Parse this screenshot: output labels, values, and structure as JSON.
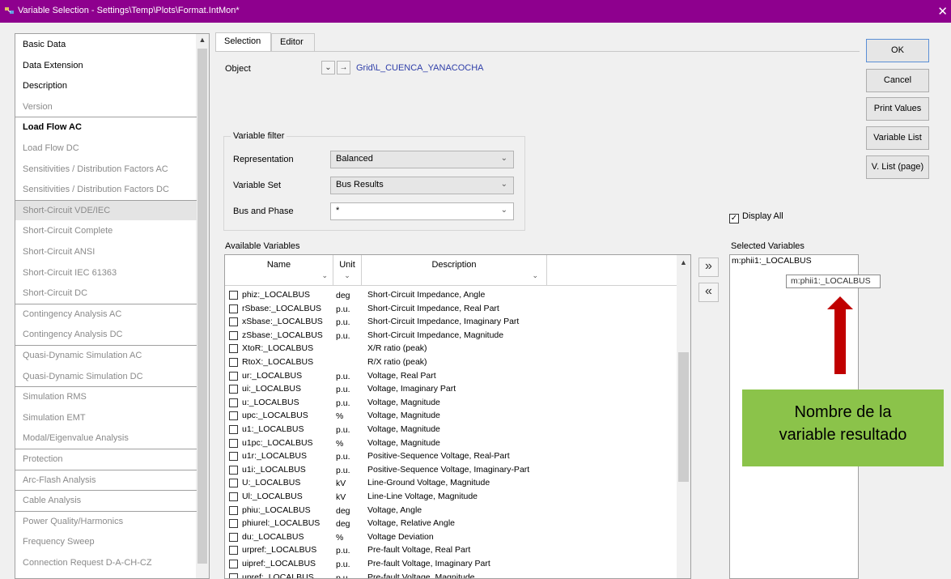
{
  "window": {
    "title": "Variable Selection - Settings\\Temp\\Plots\\Format.IntMon*",
    "close": "✕"
  },
  "sidebar": {
    "items": [
      {
        "label": "Basic Data",
        "active": true
      },
      {
        "label": "Data Extension",
        "active": true
      },
      {
        "label": "Description",
        "active": true
      },
      {
        "label": "Version",
        "active": false
      },
      {
        "label": "Load Flow AC",
        "active": true,
        "bold": true
      },
      {
        "label": "Load Flow DC",
        "active": false
      },
      {
        "label": "Sensitivities / Distribution Factors AC",
        "active": false
      },
      {
        "label": "Sensitivities / Distribution Factors DC",
        "active": false
      },
      {
        "label": "Short-Circuit VDE/IEC",
        "active": false,
        "selected": true
      },
      {
        "label": "Short-Circuit Complete",
        "active": false
      },
      {
        "label": "Short-Circuit ANSI",
        "active": false
      },
      {
        "label": "Short-Circuit IEC 61363",
        "active": false
      },
      {
        "label": "Short-Circuit DC",
        "active": false
      },
      {
        "label": "Contingency Analysis AC",
        "active": false
      },
      {
        "label": "Contingency Analysis DC",
        "active": false
      },
      {
        "label": "Quasi-Dynamic Simulation AC",
        "active": false
      },
      {
        "label": "Quasi-Dynamic Simulation DC",
        "active": false
      },
      {
        "label": "Simulation RMS",
        "active": false
      },
      {
        "label": "Simulation EMT",
        "active": false
      },
      {
        "label": "Modal/Eigenvalue Analysis",
        "active": false
      },
      {
        "label": "Protection",
        "active": false
      },
      {
        "label": "Arc-Flash Analysis",
        "active": false
      },
      {
        "label": "Cable Analysis",
        "active": false
      },
      {
        "label": "Power Quality/Harmonics",
        "active": false
      },
      {
        "label": "Frequency Sweep",
        "active": false
      },
      {
        "label": "Connection Request D-A-CH-CZ",
        "active": false
      }
    ]
  },
  "tabs": [
    {
      "label": "Selection",
      "selected": true
    },
    {
      "label": "Editor",
      "selected": false
    }
  ],
  "object": {
    "label": "Object",
    "value": "Grid\\L_CUENCA_YANACOCHA",
    "dropdown_glyph": "⌄",
    "goto_glyph": "→"
  },
  "filter": {
    "title": "Variable filter",
    "representation": {
      "label": "Representation",
      "value": "Balanced"
    },
    "variable_set": {
      "label": "Variable Set",
      "value": "Bus Results"
    },
    "bus_phase": {
      "label": "Bus and Phase",
      "value": "*"
    }
  },
  "available": {
    "label": "Available Variables",
    "columns": [
      "Name",
      "Unit",
      "Description"
    ],
    "rows": [
      {
        "name": "phiz:_LOCALBUS",
        "unit": "deg",
        "desc": "Short-Circuit Impedance, Angle"
      },
      {
        "name": "rSbase:_LOCALBUS",
        "unit": "p.u.",
        "desc": "Short-Circuit Impedance, Real Part"
      },
      {
        "name": "xSbase:_LOCALBUS",
        "unit": "p.u.",
        "desc": "Short-Circuit Impedance, Imaginary Part"
      },
      {
        "name": "zSbase:_LOCALBUS",
        "unit": "p.u.",
        "desc": "Short-Circuit Impedance, Magnitude"
      },
      {
        "name": "XtoR:_LOCALBUS",
        "unit": "",
        "desc": "X/R ratio (peak)"
      },
      {
        "name": "RtoX:_LOCALBUS",
        "unit": "",
        "desc": "R/X ratio (peak)"
      },
      {
        "name": "ur:_LOCALBUS",
        "unit": "p.u.",
        "desc": "Voltage, Real Part"
      },
      {
        "name": "ui:_LOCALBUS",
        "unit": "p.u.",
        "desc": "Voltage, Imaginary Part"
      },
      {
        "name": "u:_LOCALBUS",
        "unit": "p.u.",
        "desc": "Voltage, Magnitude"
      },
      {
        "name": "upc:_LOCALBUS",
        "unit": "%",
        "desc": "Voltage, Magnitude"
      },
      {
        "name": "u1:_LOCALBUS",
        "unit": "p.u.",
        "desc": "Voltage, Magnitude"
      },
      {
        "name": "u1pc:_LOCALBUS",
        "unit": "%",
        "desc": "Voltage, Magnitude"
      },
      {
        "name": "u1r:_LOCALBUS",
        "unit": "p.u.",
        "desc": "Positive-Sequence Voltage, Real-Part"
      },
      {
        "name": "u1i:_LOCALBUS",
        "unit": "p.u.",
        "desc": "Positive-Sequence Voltage, Imaginary-Part"
      },
      {
        "name": "U:_LOCALBUS",
        "unit": "kV",
        "desc": "Line-Ground Voltage, Magnitude"
      },
      {
        "name": "Ul:_LOCALBUS",
        "unit": "kV",
        "desc": "Line-Line Voltage, Magnitude"
      },
      {
        "name": "phiu:_LOCALBUS",
        "unit": "deg",
        "desc": "Voltage, Angle"
      },
      {
        "name": "phiurel:_LOCALBUS",
        "unit": "deg",
        "desc": "Voltage, Relative Angle"
      },
      {
        "name": "du:_LOCALBUS",
        "unit": "%",
        "desc": "Voltage Deviation"
      },
      {
        "name": "urpref:_LOCALBUS",
        "unit": "p.u.",
        "desc": "Pre-fault Voltage, Real Part"
      },
      {
        "name": "uipref:_LOCALBUS",
        "unit": "p.u.",
        "desc": "Pre-fault Voltage, Imaginary Part"
      },
      {
        "name": "upref:_LOCALBUS",
        "unit": "p.u.",
        "desc": "Pre-fault Voltage, Magnitude"
      }
    ]
  },
  "move_buttons": {
    "add": "»",
    "remove": "«"
  },
  "display_all": {
    "label": "Display All",
    "checked": true,
    "check_glyph": "✓"
  },
  "selected": {
    "label": "Selected Variables",
    "items": [
      "m:phii1:_LOCALBUS"
    ],
    "tooltip": "m:phii1:_LOCALBUS"
  },
  "annotation": {
    "line1": "Nombre de la",
    "line2": "variable resultado",
    "color": "#8bc34a",
    "arrow_color": "#c00000"
  },
  "buttons": {
    "ok": "OK",
    "cancel": "Cancel",
    "print_values": "Print Values",
    "variable_list": "Variable List",
    "vlist_page": "V. List (page)"
  },
  "colors": {
    "titlebar": "#8e008e",
    "link": "#2e3ea8"
  }
}
